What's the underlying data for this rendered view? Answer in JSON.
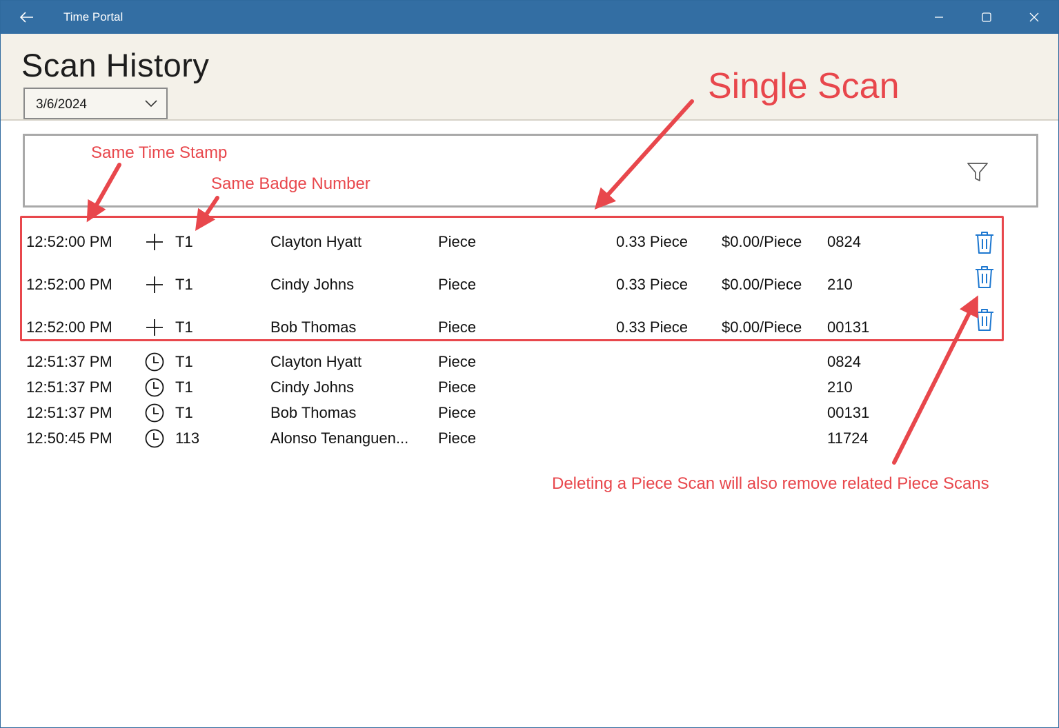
{
  "window": {
    "title": "Time Portal"
  },
  "header": {
    "title": "Scan History",
    "date_value": "3/6/2024"
  },
  "colors": {
    "titlebar": "#336ea3",
    "header_bg": "#f4f1e9",
    "accent_blue": "#1e78d0",
    "annotation_red": "#e8474c"
  },
  "icons": {
    "back": "arrow-left-icon",
    "minimize": "minimize-icon",
    "maximize": "maximize-icon",
    "close": "close-icon",
    "filter": "filter-icon",
    "add": "plus-icon",
    "clock": "clock-icon",
    "delete": "trash-icon"
  },
  "rows": [
    {
      "time": "12:52:00 PM",
      "icon": "plus",
      "badge": "T1",
      "name": "Clayton Hyatt",
      "type": "Piece",
      "qty": "0.33 Piece",
      "rate": "$0.00/Piece",
      "id": "0824",
      "deletable": true
    },
    {
      "time": "12:52:00 PM",
      "icon": "plus",
      "badge": "T1",
      "name": "Cindy Johns",
      "type": "Piece",
      "qty": "0.33 Piece",
      "rate": "$0.00/Piece",
      "id": "210",
      "deletable": true
    },
    {
      "time": "12:52:00 PM",
      "icon": "plus",
      "badge": "T1",
      "name": "Bob Thomas",
      "type": "Piece",
      "qty": "0.33 Piece",
      "rate": "$0.00/Piece",
      "id": "00131",
      "deletable": true
    },
    {
      "time": "12:51:37 PM",
      "icon": "clock",
      "badge": "T1",
      "name": "Clayton Hyatt",
      "type": "Piece",
      "qty": "",
      "rate": "",
      "id": "0824",
      "deletable": false
    },
    {
      "time": "12:51:37 PM",
      "icon": "clock",
      "badge": "T1",
      "name": "Cindy Johns",
      "type": "Piece",
      "qty": "",
      "rate": "",
      "id": "210",
      "deletable": false
    },
    {
      "time": "12:51:37 PM",
      "icon": "clock",
      "badge": "T1",
      "name": "Bob Thomas",
      "type": "Piece",
      "qty": "",
      "rate": "",
      "id": "00131",
      "deletable": false
    },
    {
      "time": "12:50:45 PM",
      "icon": "clock",
      "badge": "113",
      "name": "Alonso Tenanguen...",
      "type": "Piece",
      "qty": "",
      "rate": "",
      "id": "11724",
      "deletable": false
    }
  ],
  "annotations": {
    "same_time": "Same Time Stamp",
    "same_badge": "Same Badge Number",
    "single_scan": "Single Scan",
    "delete_note": "Deleting a Piece Scan will also remove related Piece Scans"
  }
}
